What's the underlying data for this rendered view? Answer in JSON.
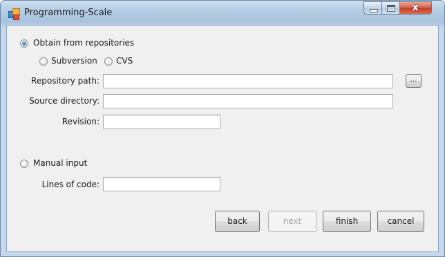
{
  "window": {
    "title": "Programming-Scale",
    "close_glyph": "x",
    "icon": "app-icon"
  },
  "source": {
    "obtain_label": "Obtain from repositories",
    "obtain_selected": true,
    "subversion_label": "Subversion",
    "cvs_label": "CVS",
    "repository_path_label": "Repository path:",
    "repository_path_value": "",
    "browse_label": "...",
    "source_directory_label": "Source directory:",
    "source_directory_value": "",
    "revision_label": "Revision:",
    "revision_value": ""
  },
  "manual": {
    "manual_input_label": "Manual input",
    "manual_selected": false,
    "lines_of_code_label": "Lines of code:",
    "lines_of_code_value": ""
  },
  "buttons": {
    "back": "back",
    "next": "next",
    "finish": "finish",
    "cancel": "cancel"
  }
}
